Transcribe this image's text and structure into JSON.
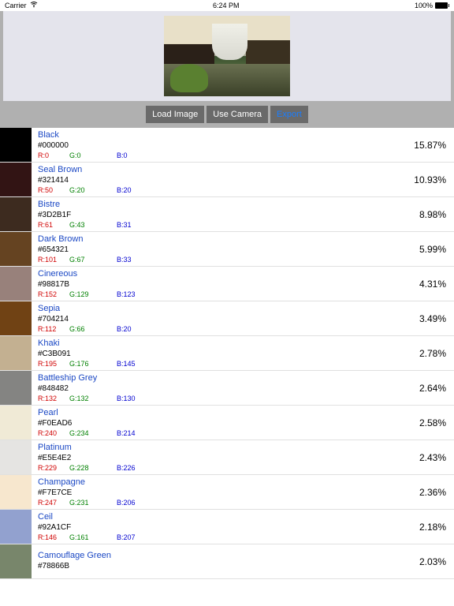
{
  "status": {
    "carrier": "Carrier",
    "time": "6:24 PM",
    "battery": "100%"
  },
  "buttons": {
    "load": "Load Image",
    "camera": "Use Camera",
    "export": "Export"
  },
  "colors": [
    {
      "name": "Black",
      "hex": "#000000",
      "r": "R:0",
      "g": "G:0",
      "b": "B:0",
      "pct": "15.87%",
      "swatch": "#000000"
    },
    {
      "name": "Seal Brown",
      "hex": "#321414",
      "r": "R:50",
      "g": "G:20",
      "b": "B:20",
      "pct": "10.93%",
      "swatch": "#321414"
    },
    {
      "name": "Bistre",
      "hex": "#3D2B1F",
      "r": "R:61",
      "g": "G:43",
      "b": "B:31",
      "pct": "8.98%",
      "swatch": "#3D2B1F"
    },
    {
      "name": "Dark Brown",
      "hex": "#654321",
      "r": "R:101",
      "g": "G:67",
      "b": "B:33",
      "pct": "5.99%",
      "swatch": "#654321"
    },
    {
      "name": "Cinereous",
      "hex": "#98817B",
      "r": "R:152",
      "g": "G:129",
      "b": "B:123",
      "pct": "4.31%",
      "swatch": "#98817B"
    },
    {
      "name": "Sepia",
      "hex": "#704214",
      "r": "R:112",
      "g": "G:66",
      "b": "B:20",
      "pct": "3.49%",
      "swatch": "#704214"
    },
    {
      "name": "Khaki",
      "hex": "#C3B091",
      "r": "R:195",
      "g": "G:176",
      "b": "B:145",
      "pct": "2.78%",
      "swatch": "#C3B091"
    },
    {
      "name": "Battleship Grey",
      "hex": "#848482",
      "r": "R:132",
      "g": "G:132",
      "b": "B:130",
      "pct": "2.64%",
      "swatch": "#848482"
    },
    {
      "name": "Pearl",
      "hex": "#F0EAD6",
      "r": "R:240",
      "g": "G:234",
      "b": "B:214",
      "pct": "2.58%",
      "swatch": "#F0EAD6"
    },
    {
      "name": "Platinum",
      "hex": "#E5E4E2",
      "r": "R:229",
      "g": "G:228",
      "b": "B:226",
      "pct": "2.43%",
      "swatch": "#E5E4E2"
    },
    {
      "name": "Champagne",
      "hex": "#F7E7CE",
      "r": "R:247",
      "g": "G:231",
      "b": "B:206",
      "pct": "2.36%",
      "swatch": "#F7E7CE"
    },
    {
      "name": "Ceil",
      "hex": "#92A1CF",
      "r": "R:146",
      "g": "G:161",
      "b": "B:207",
      "pct": "2.18%",
      "swatch": "#92A1CF"
    },
    {
      "name": "Camouflage Green",
      "hex": "#78866B",
      "r": "",
      "g": "",
      "b": "",
      "pct": "2.03%",
      "swatch": "#78866B"
    }
  ]
}
